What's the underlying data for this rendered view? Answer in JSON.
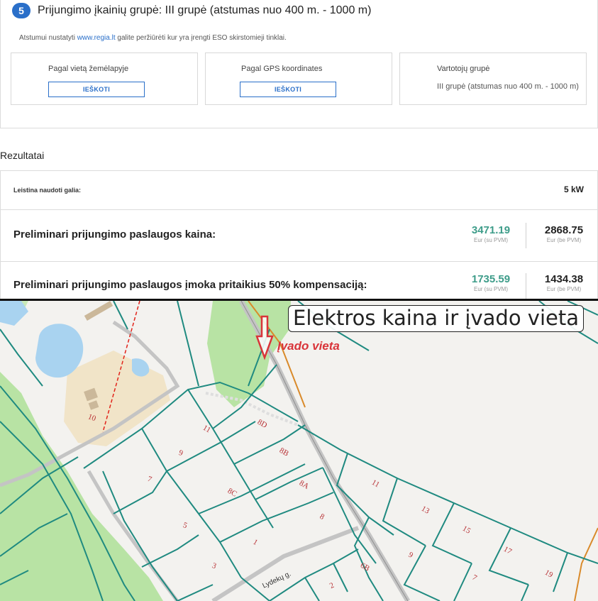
{
  "step": {
    "number": "5",
    "title": "Prijungimo įkainių grupė: III grupė (atstumas nuo 400 m. - 1000 m)",
    "note_before": "Atstumui nustatyti ",
    "note_link": "www.regia.lt",
    "note_after": " galite peržiūrėti kur yra įrengti ESO skirstomieji tinklai.",
    "cards": [
      {
        "label": "Pagal vietą žemėlapyje",
        "button": "IEŠKOTI"
      },
      {
        "label": "Pagal GPS koordinates",
        "button": "IEŠKOTI"
      },
      {
        "label": "Vartotojų grupė",
        "value": "III grupė (atstumas nuo 400 m. - 1000 m)"
      }
    ]
  },
  "results": {
    "heading": "Rezultatai",
    "allowed_power_label": "Leistina naudoti galia:",
    "allowed_power_value": "5 kW",
    "price_label": "Preliminari prijungimo paslaugos kaina:",
    "price_with_vat": "3471.19",
    "price_with_vat_unit": "Eur (su PVM)",
    "price_without_vat": "2868.75",
    "price_without_vat_unit": "Eur (be PVM)",
    "comp_label": "Preliminari prijungimo paslaugos įmoka pritaikius 50% kompensaciją:",
    "comp_with_vat": "1735.59",
    "comp_with_vat_unit": "Eur (su PVM)",
    "comp_without_vat": "1434.38",
    "comp_without_vat_unit": "Eur (be PVM)"
  },
  "map": {
    "caption": "Elektros kaina ir įvado vieta",
    "entry_label": "Įvado vieta",
    "street_label": "Lydekų g.",
    "parcel_labels": [
      "10",
      "11",
      "9",
      "7",
      "5",
      "3",
      "8D",
      "8B",
      "8C",
      "8A",
      "8",
      "1",
      "6B",
      "2",
      "11",
      "13",
      "15",
      "17",
      "19",
      "9",
      "7"
    ],
    "colors": {
      "parcel_line": "#1f8a80",
      "parcel_number": "#b83236",
      "water": "#a9d3f0",
      "forest": "#b8e3a4",
      "road": "#b9b9b9",
      "power_line": "#e2231a",
      "arrow": "#d9343a",
      "orange_line": "#d98a2a"
    }
  }
}
